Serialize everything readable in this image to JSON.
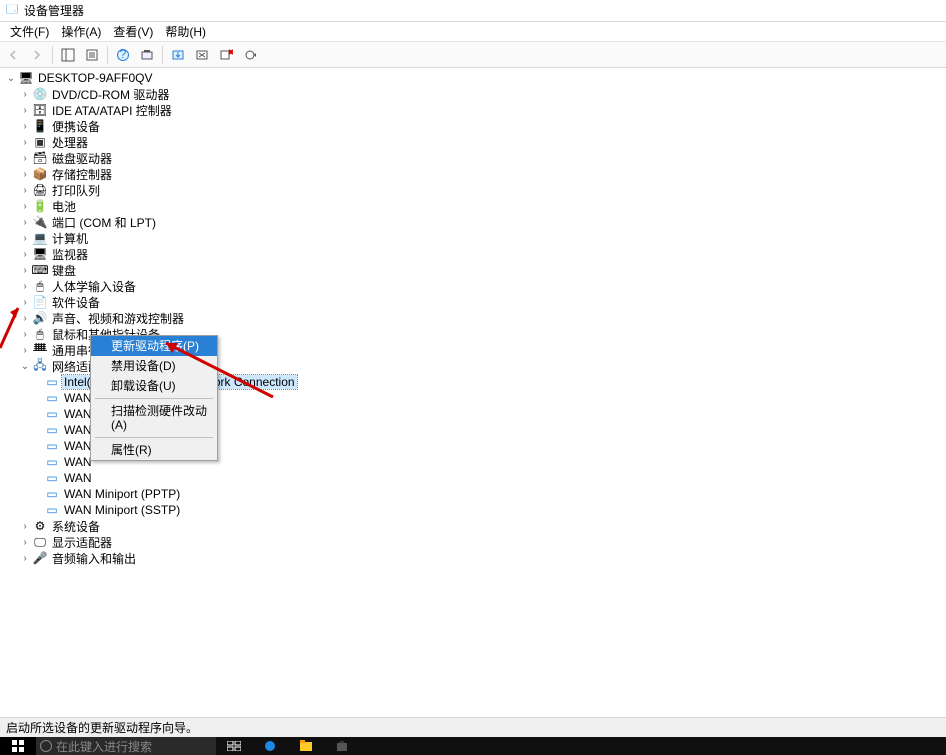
{
  "window": {
    "title": "设备管理器"
  },
  "menu": {
    "file": "文件(F)",
    "action": "操作(A)",
    "view": "查看(V)",
    "help": "帮助(H)"
  },
  "tree": {
    "root": "DESKTOP-9AFF0QV",
    "categories": [
      {
        "label": "DVD/CD-ROM 驱动器",
        "icon": "ic-disc"
      },
      {
        "label": "IDE ATA/ATAPI 控制器",
        "icon": "ic-ide"
      },
      {
        "label": "便携设备",
        "icon": "ic-portable"
      },
      {
        "label": "处理器",
        "icon": "ic-cpu"
      },
      {
        "label": "磁盘驱动器",
        "icon": "ic-disk"
      },
      {
        "label": "存储控制器",
        "icon": "ic-storage"
      },
      {
        "label": "打印队列",
        "icon": "ic-printer"
      },
      {
        "label": "电池",
        "icon": "ic-battery"
      },
      {
        "label": "端口 (COM 和 LPT)",
        "icon": "ic-port"
      },
      {
        "label": "计算机",
        "icon": "ic-pc"
      },
      {
        "label": "监视器",
        "icon": "ic-monitor"
      },
      {
        "label": "键盘",
        "icon": "ic-keyboard"
      },
      {
        "label": "人体学输入设备",
        "icon": "ic-hid"
      },
      {
        "label": "软件设备",
        "icon": "ic-software"
      },
      {
        "label": "声音、视频和游戏控制器",
        "icon": "ic-sound"
      },
      {
        "label": "鼠标和其他指针设备",
        "icon": "ic-mouse"
      },
      {
        "label": "通用串行总线控制器",
        "icon": "ic-usb"
      },
      {
        "label": "网络适配器",
        "icon": "ic-network",
        "expanded": true
      },
      {
        "label": "系统设备",
        "icon": "ic-system"
      },
      {
        "label": "显示适配器",
        "icon": "ic-display"
      },
      {
        "label": "音频输入和输出",
        "icon": "ic-audio"
      }
    ],
    "network_children": [
      {
        "label": "Intel(R) PRO/1000 MT Network Connection",
        "selected": true
      },
      {
        "label": "WAN"
      },
      {
        "label": "WAN"
      },
      {
        "label": "WAN"
      },
      {
        "label": "WAN"
      },
      {
        "label": "WAN"
      },
      {
        "label": "WAN"
      },
      {
        "label": "WAN Miniport (PPTP)"
      },
      {
        "label": "WAN Miniport (SSTP)"
      }
    ]
  },
  "context_menu": {
    "items": [
      {
        "label": "更新驱动程序(P)",
        "highlighted": true
      },
      {
        "label": "禁用设备(D)"
      },
      {
        "label": "卸载设备(U)"
      },
      {
        "sep": true
      },
      {
        "label": "扫描检测硬件改动(A)"
      },
      {
        "sep": true
      },
      {
        "label": "属性(R)"
      }
    ]
  },
  "statusbar": {
    "text": "启动所选设备的更新驱动程序向导。"
  },
  "taskbar": {
    "search_placeholder": "在此键入进行搜索"
  }
}
